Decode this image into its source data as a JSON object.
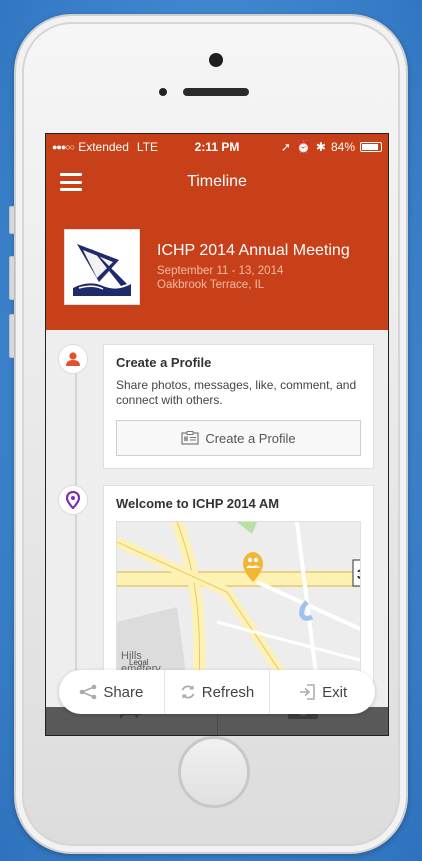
{
  "status_bar": {
    "carrier": "Extended",
    "network": "LTE",
    "time": "2:11 PM",
    "battery": "84%"
  },
  "nav": {
    "title": "Timeline"
  },
  "event": {
    "name": "ICHP 2014 Annual Meeting",
    "dates": "September 11 - 13, 2014",
    "location": "Oakbrook Terrace, IL"
  },
  "timeline": {
    "profile_card": {
      "title": "Create a Profile",
      "text": "Share photos, messages, like, comment, and connect with others.",
      "button_label": "Create a Profile"
    },
    "welcome_card": {
      "title": "Welcome to ICHP 2014 AM",
      "map_label_hills": "Hills",
      "map_label_legal": "Legal",
      "map_label_cemetery": "emetery",
      "map_route": "3"
    }
  },
  "toolbar": {
    "share_label": "Share",
    "refresh_label": "Refresh",
    "exit_label": "Exit"
  },
  "colors": {
    "brand": "#c8401a",
    "background": "#3f86cf"
  }
}
